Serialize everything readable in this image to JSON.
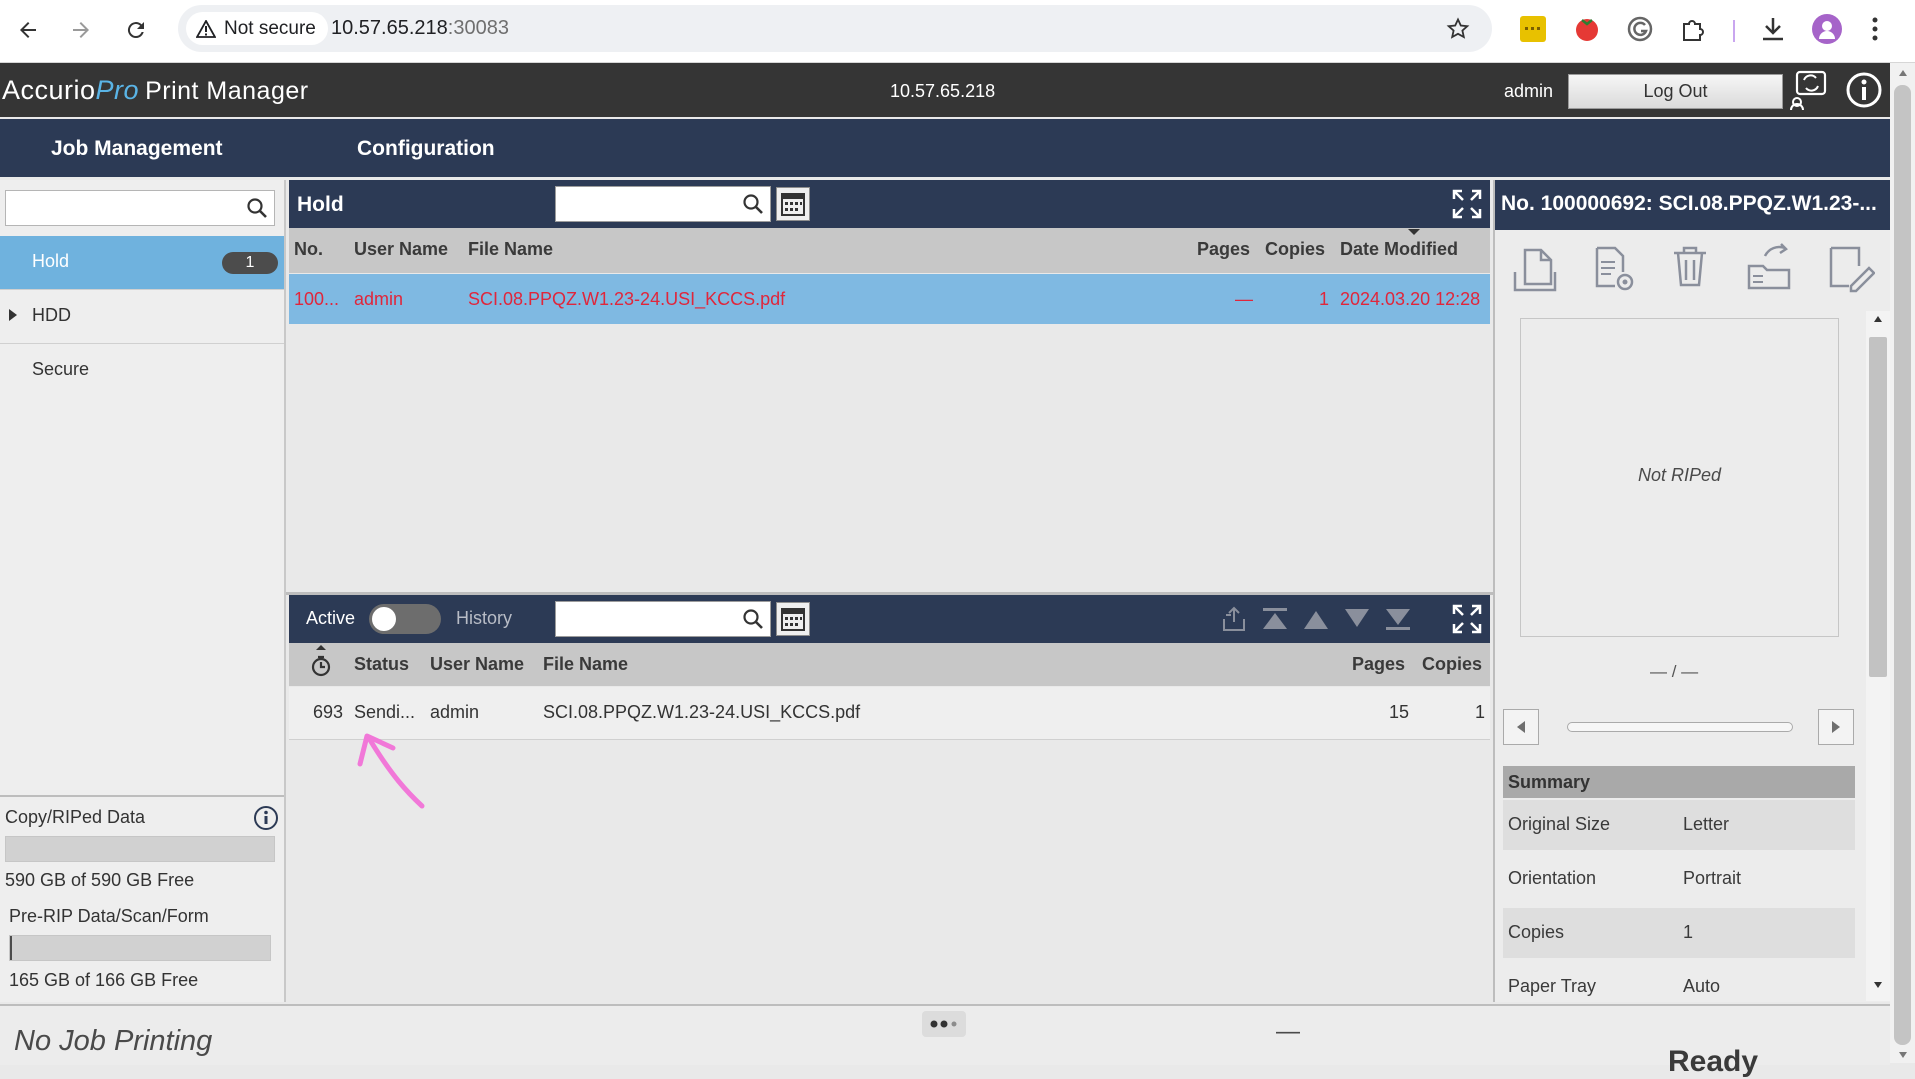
{
  "browser": {
    "security_label": "Not secure",
    "url_host": "10.57.65.218",
    "url_port": ":30083"
  },
  "header": {
    "logo_accurio": "Accurio",
    "logo_pro": "Pro",
    "logo_print_manager": "Print Manager",
    "ip": "10.57.65.218",
    "user": "admin",
    "logout_label": "Log Out"
  },
  "tabs": [
    {
      "label": "Job Management"
    },
    {
      "label": "Configuration"
    }
  ],
  "sidebar": {
    "items": [
      {
        "label": "Hold",
        "count": "1"
      },
      {
        "label": "HDD"
      },
      {
        "label": "Secure"
      }
    ],
    "storage": [
      {
        "label": "Copy/RIPed Data",
        "free_text": "590 GB of 590 GB Free",
        "used_fraction": 0.0
      },
      {
        "label": "Pre-RIP Data/Scan/Form",
        "free_text": "165 GB of 166 GB Free",
        "used_fraction": 0.006
      }
    ]
  },
  "hold_panel": {
    "title": "Hold",
    "columns": [
      "No.",
      "User Name",
      "File Name",
      "Pages",
      "Copies",
      "Date Modified"
    ],
    "rows": [
      {
        "no": "100...",
        "user": "admin",
        "file": "SCI.08.PPQZ.W1.23-24.USI_KCCS.pdf",
        "pages": "—",
        "copies": "1",
        "date": "2024.03.20 12:28"
      }
    ]
  },
  "active_panel": {
    "active_label": "Active",
    "history_label": "History",
    "columns": [
      "Status",
      "User Name",
      "File Name",
      "Pages",
      "Copies"
    ],
    "rows": [
      {
        "id": "693",
        "status": "Sendi...",
        "user": "admin",
        "file": "SCI.08.PPQZ.W1.23-24.USI_KCCS.pdf",
        "pages": "15",
        "copies": "1"
      }
    ]
  },
  "detail_panel": {
    "title": "No. 100000692: SCI.08.PPQZ.W1.23-...",
    "preview_text": "Not RIPed",
    "page_indicator": "— / —",
    "summary_title": "Summary",
    "summary": [
      {
        "key": "Original Size",
        "value": "Letter"
      },
      {
        "key": "Orientation",
        "value": "Portrait"
      },
      {
        "key": "Copies",
        "value": "1"
      },
      {
        "key": "Paper Tray",
        "value": "Auto"
      }
    ]
  },
  "status_bar": {
    "printing_text": "No Job Printing",
    "dash": "—",
    "ready_text": "Ready"
  },
  "colors": {
    "nav_dark": "#2c3a55",
    "selection_blue": "#7fb9e2",
    "hold_text_red": "#e0263b",
    "annotation_pink": "#f178d8"
  }
}
